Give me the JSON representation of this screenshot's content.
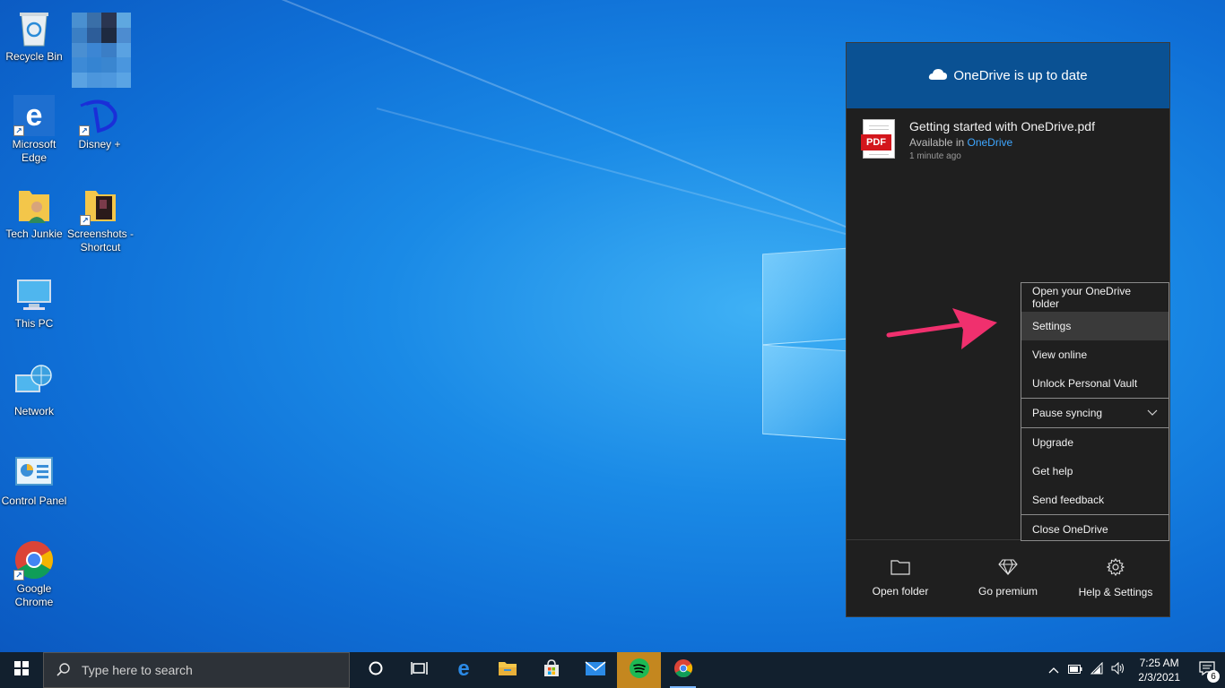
{
  "desktop": {
    "icons": [
      {
        "label": "Recycle Bin",
        "icon": "recycle-bin-icon"
      },
      {
        "label": "Microsoft Edge",
        "icon": "edge-icon"
      },
      {
        "label": "Disney +",
        "icon": "disney-plus-icon"
      },
      {
        "label": "Tech Junkie",
        "icon": "user-folder-icon"
      },
      {
        "label": "Screenshots - Shortcut",
        "icon": "folder-shortcut-icon"
      },
      {
        "label": "This PC",
        "icon": "computer-icon"
      },
      {
        "label": "Network",
        "icon": "network-icon"
      },
      {
        "label": "Control Panel",
        "icon": "control-panel-icon"
      },
      {
        "label": "Google Chrome",
        "icon": "chrome-icon"
      }
    ]
  },
  "onedrive": {
    "header": "OneDrive is up to date",
    "file": {
      "name": "Getting started with OneDrive.pdf",
      "available_prefix": "Available in",
      "available_link": "OneDrive",
      "time": "1 minute ago",
      "badge": "PDF"
    },
    "menu": {
      "open_folder": "Open your OneDrive folder",
      "settings": "Settings",
      "view_online": "View online",
      "unlock_vault": "Unlock Personal Vault",
      "pause_syncing": "Pause syncing",
      "upgrade": "Upgrade",
      "get_help": "Get help",
      "send_feedback": "Send feedback",
      "close": "Close OneDrive"
    },
    "footer": {
      "open_folder": "Open folder",
      "go_premium": "Go premium",
      "help_settings": "Help & Settings"
    }
  },
  "taskbar": {
    "search_placeholder": "Type here to search",
    "apps": [
      "cortana-icon",
      "task-view-icon",
      "edge-icon",
      "file-explorer-icon",
      "store-icon",
      "mail-icon",
      "spotify-icon",
      "chrome-icon"
    ],
    "time": "7:25 AM",
    "date": "2/3/2021",
    "notification_count": "6"
  },
  "colors": {
    "flyout_header": "#0a5193",
    "flyout_bg": "#1f1f1f",
    "link": "#3ea6ff",
    "arrow": "#f0306e",
    "taskbar": "#12202e"
  }
}
